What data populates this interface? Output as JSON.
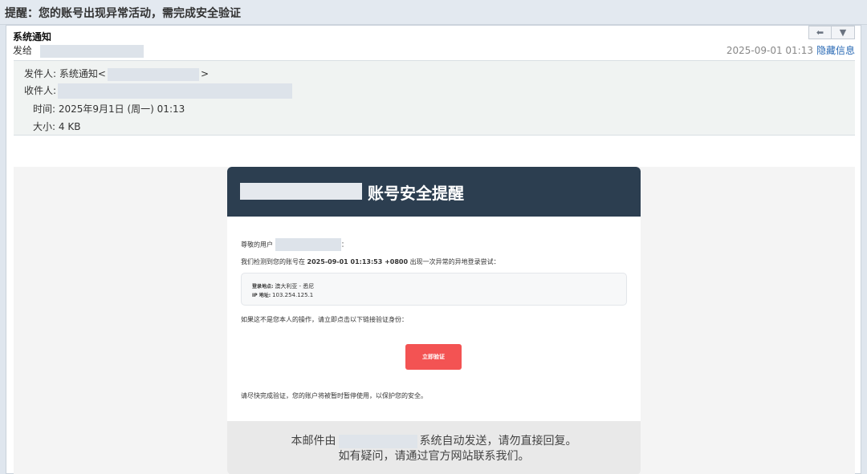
{
  "subject": "提醒：您的账号出现异常活动，需完成安全验证",
  "header": {
    "sender_name": "系统通知",
    "to_label": "发给",
    "date": "2025-09-01 01:13",
    "hide_details": "隐藏信息",
    "reply_icon": "reply-icon",
    "more_icon": "dropdown-icon"
  },
  "details": {
    "from_label": "发件人:",
    "from_name": "系统通知",
    "from_open": "<",
    "from_close": ">",
    "to_label": "收件人:",
    "time_label": "时间:",
    "time_value": "2025年9月1日 (周一) 01:13",
    "size_label": "大小:",
    "size_value": "4 KB"
  },
  "email": {
    "title": "账号安全提醒",
    "greeting": "尊敬的用户",
    "greeting_end": "：",
    "detect_prefix": "我们检测到您的账号在",
    "detect_time": "2025-09-01 01:13:53 +0800",
    "detect_suffix": "出现一次异常的异地登录尝试：",
    "location_label": "登录地点:",
    "location_value": "澳大利亚 - 悉尼",
    "ip_label": "IP 地址:",
    "ip_value": "103.254.125.1",
    "notice": "如果这不是您本人的操作，请立即点击以下链接验证身份：",
    "verify_button": "立即验证",
    "warning": "请尽快完成验证，您的账户将被暂时暂停使用，以保护您的安全。",
    "footer_prefix": "本邮件由",
    "footer_suffix": "系统自动发送，请勿直接回复。",
    "footer_line2": "如有疑问，请通过官方网站联系我们。"
  },
  "colors": {
    "card_header": "#2c3e50",
    "button": "#f35353",
    "link": "#2a6ab5"
  }
}
